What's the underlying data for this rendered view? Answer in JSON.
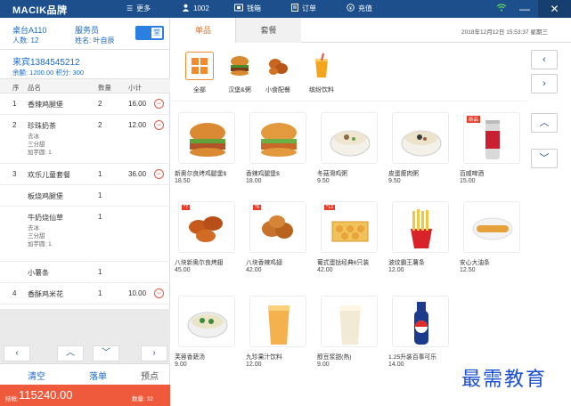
{
  "topbar": {
    "logo": "MACIK品牌",
    "more": "更多",
    "user": "1002",
    "cashbox": "钱箱",
    "orders": "订单",
    "recharge": "充值"
  },
  "table": {
    "name": "桌台A110",
    "people": "人数: 12",
    "waiter_label": "服务员",
    "waiter_name": "姓名: 叶自辰",
    "toggle_label": "堂"
  },
  "member": {
    "name": "来宾1384545212",
    "balance": "余额: 1200.00    积分: 300"
  },
  "order_header": {
    "seq": "序",
    "name": "品名",
    "qty": "数量",
    "subtotal": "小计"
  },
  "orders": [
    {
      "seq": "1",
      "name": "香辣鸡腿堡",
      "qty": "2",
      "subtotal": "16.00",
      "options": []
    },
    {
      "seq": "2",
      "name": "珍珠奶茶",
      "qty": "2",
      "subtotal": "12.00",
      "options": [
        "去冰",
        "三分甜",
        "加芋圆: 1"
      ]
    },
    {
      "seq": "3",
      "name": "欢乐儿童套餐",
      "qty": "1",
      "subtotal": "36.00",
      "options": []
    },
    {
      "seq": "",
      "name": "板烧鸡腿堡",
      "qty": "1",
      "subtotal": "",
      "options": []
    },
    {
      "seq": "",
      "name": "牛奶烧仙草",
      "qty": "1",
      "subtotal": "",
      "options": [
        "去冰",
        "三分甜",
        "加芋圆: 1"
      ]
    },
    {
      "seq": "",
      "name": "小薯条",
      "qty": "1",
      "subtotal": "",
      "options": []
    },
    {
      "seq": "4",
      "name": "香酥鸡米花",
      "qty": "1",
      "subtotal": "10.00",
      "options": []
    }
  ],
  "actions": {
    "clear": "清空",
    "place": "落单",
    "pre": "预点"
  },
  "totals": {
    "label": "结帐:",
    "amount": "115240.00",
    "qty": "数量: 32"
  },
  "tabs": {
    "single": "单品",
    "combo": "套餐"
  },
  "datetime": "2018年12月12日 15:53:37  星期三",
  "categories": [
    "全部",
    "汉堡&粥",
    "小食配餐",
    "缤纷饮料"
  ],
  "products": [
    {
      "name": "新奥尔良烤鸡腿堡$",
      "price": "18.50",
      "tag": ""
    },
    {
      "name": "香辣鸡腿堡$",
      "price": "18.00",
      "tag": ""
    },
    {
      "name": "冬菇滑鸡粥",
      "price": "9.50",
      "tag": ""
    },
    {
      "name": "皮蛋瘦肉粥",
      "price": "9.50",
      "tag": ""
    },
    {
      "name": "百威啤酒",
      "price": "15.00",
      "tag": "新品"
    },
    {
      "name": "八块新奥尔良烤翅",
      "price": "45.00",
      "tag": "*7"
    },
    {
      "name": "八块香辣鸡翅",
      "price": "42.00",
      "tag": "*6"
    },
    {
      "name": "葡式蛋挞经典6只装",
      "price": "42.00",
      "tag": "*12"
    },
    {
      "name": "波纹霸王薯条",
      "price": "12.00",
      "tag": ""
    },
    {
      "name": "安心大油条",
      "price": "12.50",
      "tag": ""
    },
    {
      "name": "芙蓉香蔬汤",
      "price": "9.00",
      "tag": ""
    },
    {
      "name": "九珍果汁饮料",
      "price": "12.00",
      "tag": ""
    },
    {
      "name": "醇豆浆甜(热)",
      "price": "9.00",
      "tag": ""
    },
    {
      "name": "1.25升装百事可乐",
      "price": "14.00",
      "tag": ""
    }
  ],
  "watermark": "最需教育",
  "colors": {
    "topbar": "#1c4f8c",
    "accent": "#e86b1f",
    "total": "#f05a3c",
    "link": "#1c6ac8"
  }
}
